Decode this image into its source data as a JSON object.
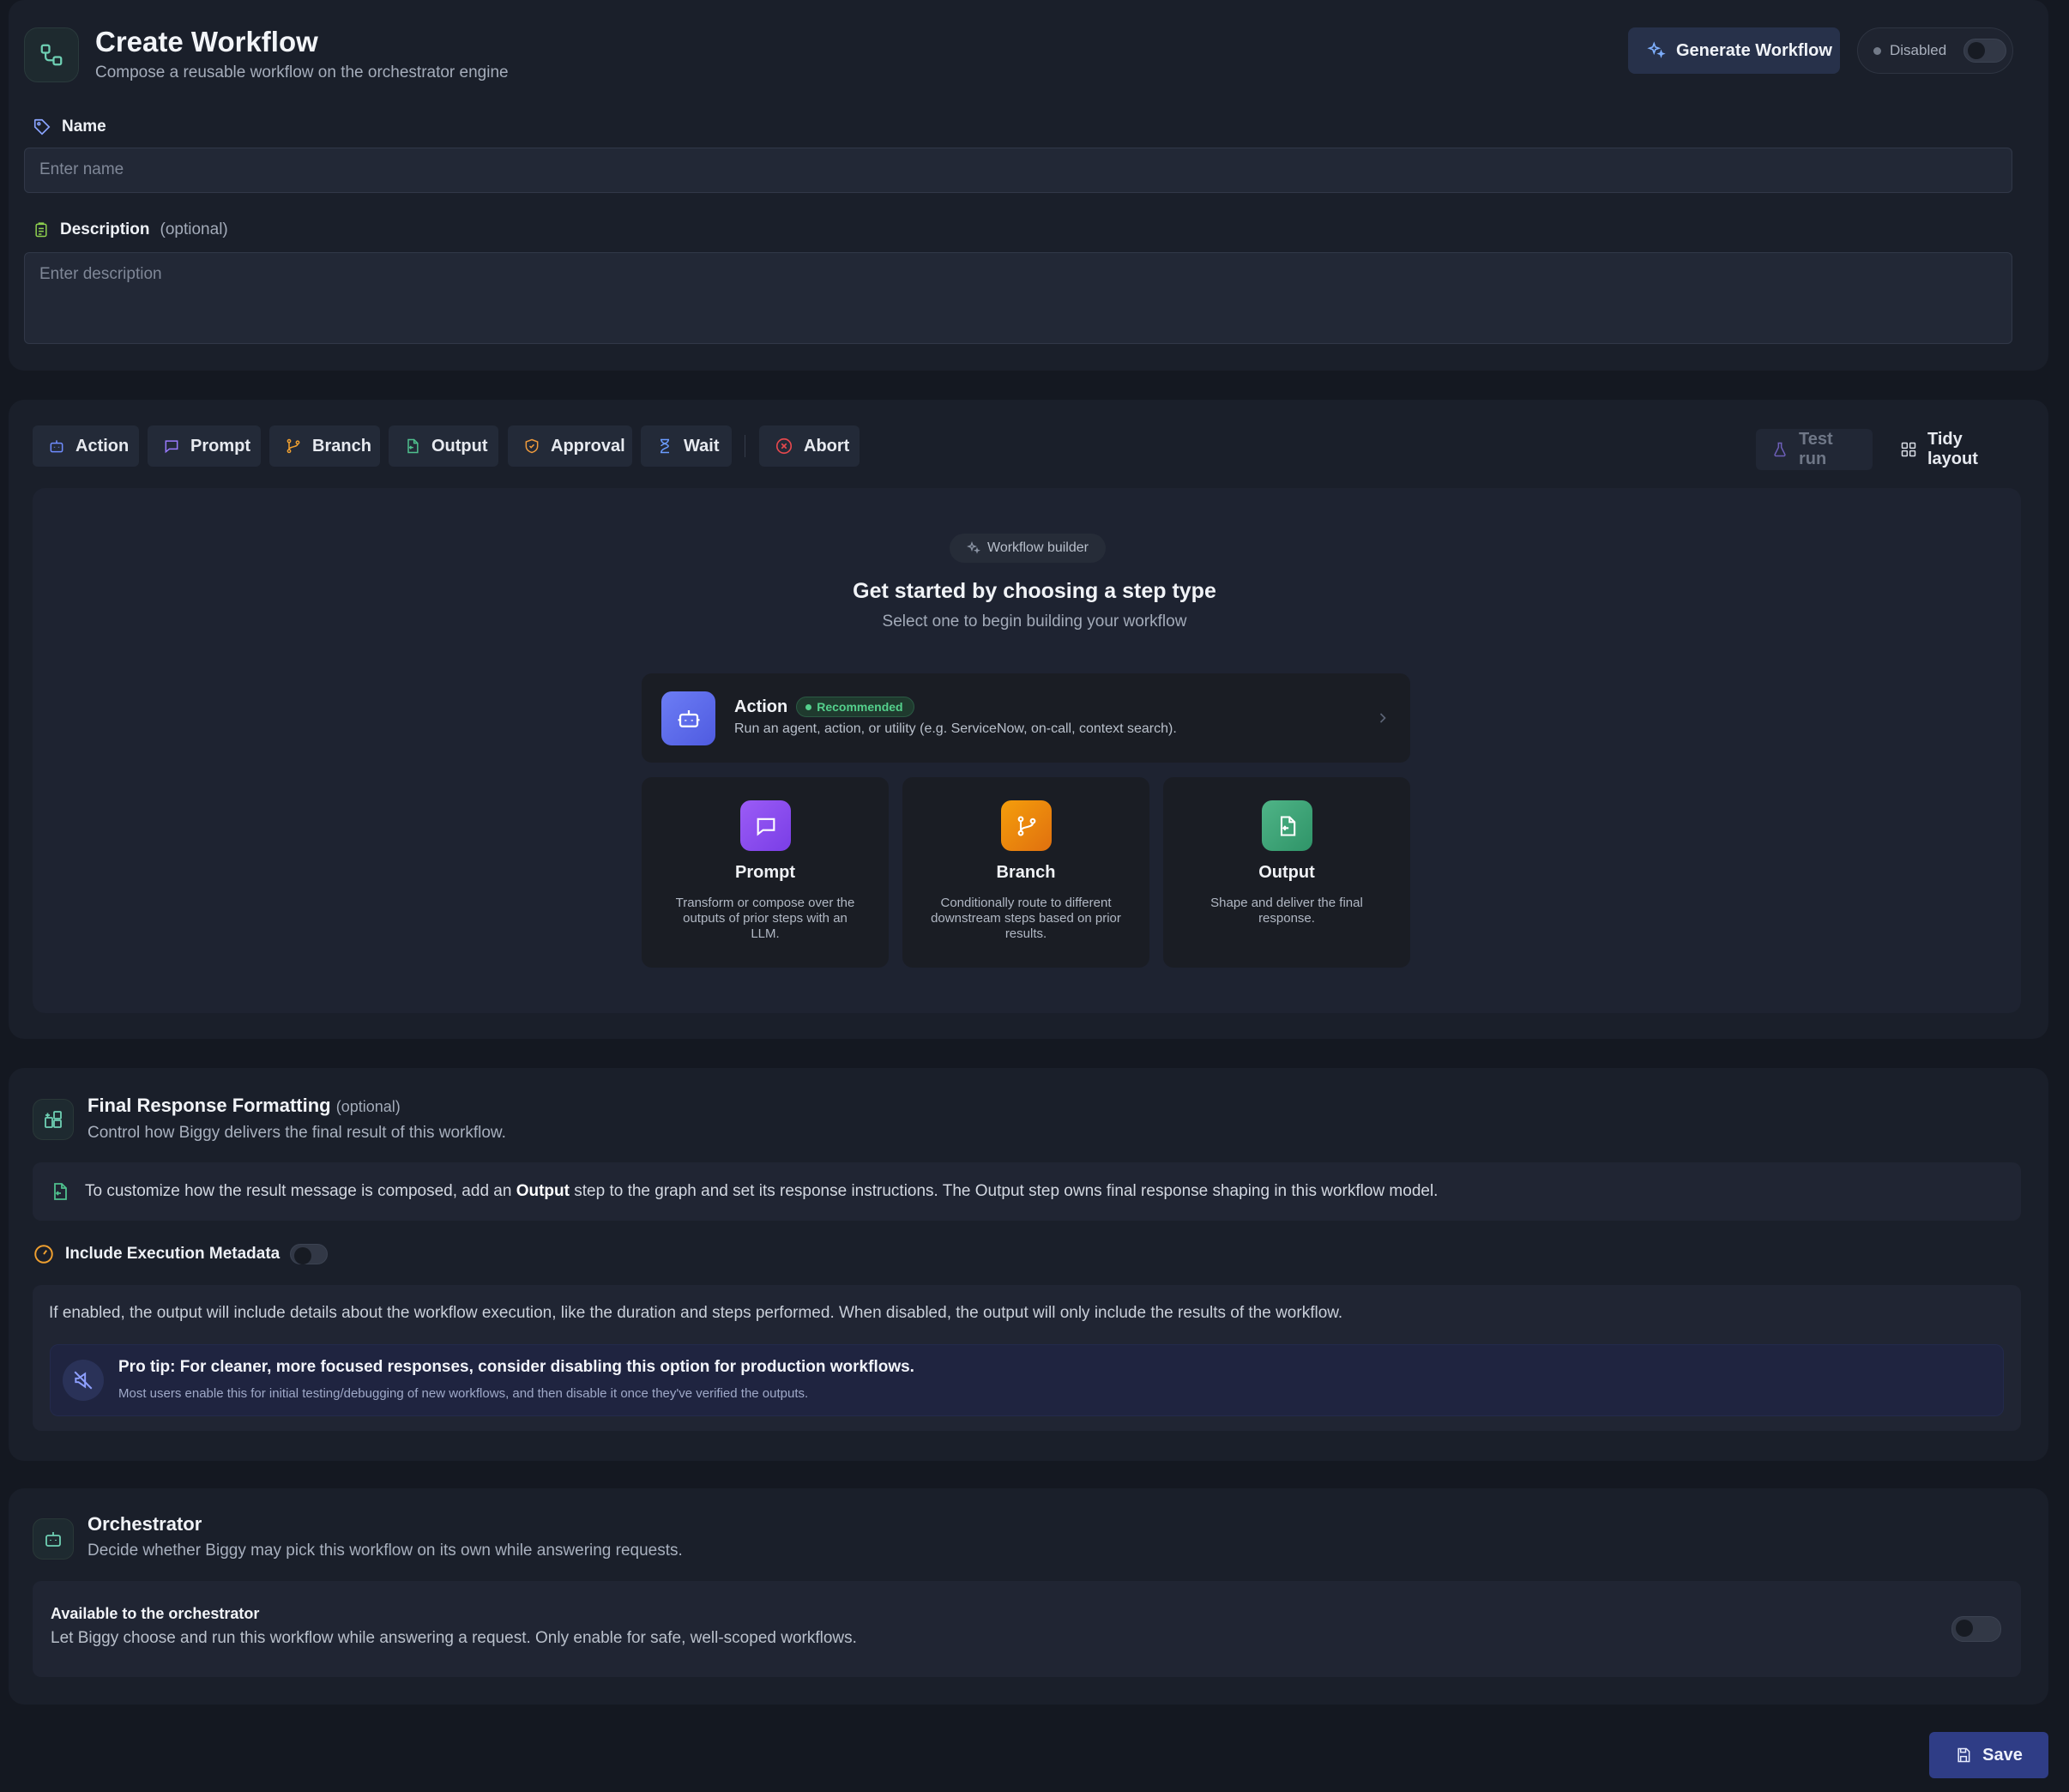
{
  "header": {
    "title": "Create Workflow",
    "subtitle": "Compose a reusable workflow on the orchestrator engine",
    "generate_label": "Generate Workflow",
    "status_label": "Disabled"
  },
  "form": {
    "name_label": "Name",
    "name_placeholder": "Enter name",
    "description_label": "Description",
    "description_optional": "(optional)",
    "description_placeholder": "Enter description"
  },
  "toolbar": {
    "steps": [
      "Action",
      "Prompt",
      "Branch",
      "Output",
      "Approval",
      "Wait",
      "Abort"
    ],
    "test_run_label": "Test run",
    "tidy_label": "Tidy layout"
  },
  "builder": {
    "pill": "Workflow builder",
    "title": "Get started by choosing a step type",
    "subtitle": "Select one to begin building your workflow",
    "action_card": {
      "title": "Action",
      "badge": "Recommended",
      "desc": "Run an agent, action, or utility (e.g. ServiceNow, on-call, context search)."
    },
    "cards": [
      {
        "title": "Prompt",
        "desc": "Transform or compose over the outputs of prior steps with an LLM."
      },
      {
        "title": "Branch",
        "desc": "Conditionally route to different downstream steps based on prior results."
      },
      {
        "title": "Output",
        "desc": "Shape and deliver the final response."
      }
    ]
  },
  "final_response": {
    "title": "Final Response Formatting",
    "optional": "(optional)",
    "subtitle": "Control how Biggy delivers the final result of this workflow.",
    "info_pre": "To customize how the result message is composed, add an ",
    "info_bold": "Output",
    "info_post": " step to the graph and set its response instructions. The Output step owns final response shaping in this workflow model.",
    "metadata_label": "Include Execution Metadata",
    "metadata_desc": "If enabled, the output will include details about the workflow execution, like the duration and steps performed. When disabled, the output will only include the results of the workflow.",
    "tip_title": "Pro tip: For cleaner, more focused responses, consider disabling this option for production workflows.",
    "tip_desc": "Most users enable this for initial testing/debugging of new workflows, and then disable it once they've verified the outputs."
  },
  "orchestrator": {
    "title": "Orchestrator",
    "subtitle": "Decide whether Biggy may pick this workflow on its own while answering requests.",
    "option_title": "Available to the orchestrator",
    "option_desc": "Let Biggy choose and run this workflow while answering a request. Only enable for safe, well-scoped workflows."
  },
  "save_label": "Save",
  "colors": {
    "accent": "#2f3d86",
    "action": "#5b6cf0",
    "prompt": "#8b4ff0",
    "branch": "#ef8a12",
    "output": "#3fa57a",
    "recommended": "#54d08c"
  }
}
